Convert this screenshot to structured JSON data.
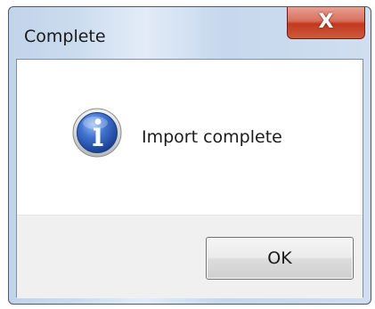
{
  "window": {
    "title": "Complete",
    "close_icon": "close-icon",
    "close_glyph": "X"
  },
  "message": {
    "icon": "info-icon",
    "text": "Import complete"
  },
  "buttons": {
    "ok_label": "OK"
  },
  "colors": {
    "close_button": "#c2391f",
    "info_icon": "#2b5bb8"
  }
}
